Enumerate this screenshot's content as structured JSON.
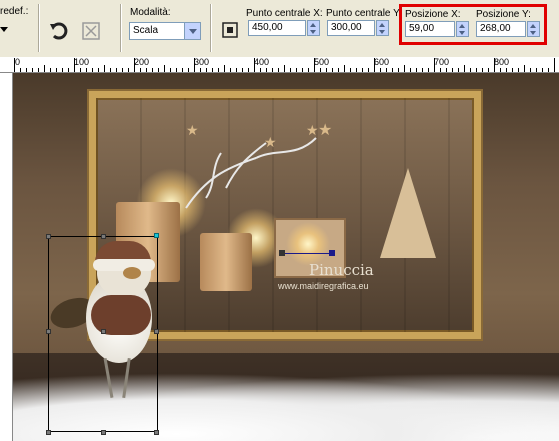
{
  "toolbar": {
    "preset_label": "redef.:",
    "mode_label": "Modalità:",
    "mode_value": "Scala",
    "center_x_label": "Punto centrale X:",
    "center_x_value": "450,00",
    "center_y_label": "Punto centrale Y:",
    "center_y_value": "300,00",
    "pos_x_label": "Posizione X:",
    "pos_x_value": "59,00",
    "pos_y_label": "Posizione Y:",
    "pos_y_value": "268,00",
    "highlight_color": "#e00000"
  },
  "ruler": {
    "labels": [
      "0",
      "100",
      "200",
      "300",
      "400",
      "500",
      "600",
      "700",
      "800"
    ]
  },
  "canvas": {
    "watermark_name": "Pinuccia",
    "watermark_url": "www.maidiregrafica.eu"
  }
}
